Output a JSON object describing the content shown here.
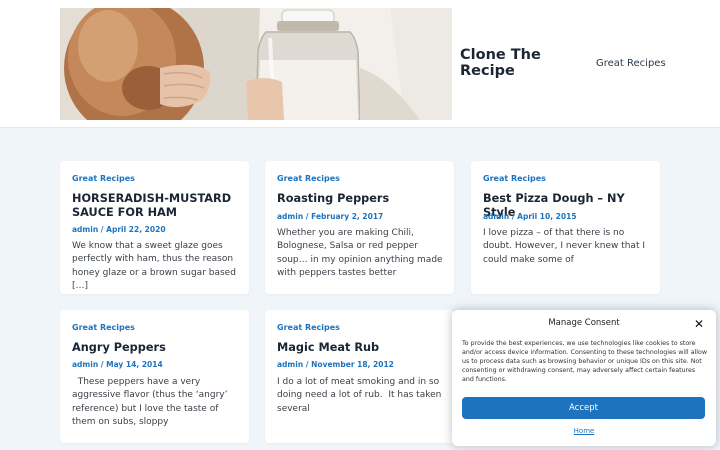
{
  "header": {
    "site_title": "Clone The Recipe",
    "nav": [
      {
        "label": "Great Recipes"
      }
    ]
  },
  "posts": [
    {
      "category": "Great Recipes",
      "title": "HORSERADISH-MUSTARD SAUCE FOR HAM",
      "author": "admin",
      "date": "April 22, 2020",
      "excerpt": "We know that a sweet glaze goes perfectly with ham, thus the reason honey glaze or a brown sugar based […]"
    },
    {
      "category": "Great Recipes",
      "title": "Roasting Peppers",
      "author": "admin",
      "date": "February 2, 2017",
      "excerpt": "Whether you are making Chili, Bolognese, Salsa or red pepper soup… in my opinion anything made with peppers tastes better"
    },
    {
      "category": "Great Recipes",
      "title": "Best Pizza Dough – NY Style",
      "author": "admin",
      "date": "April 10, 2015",
      "excerpt": "I love pizza – of that there is no doubt. However, I never knew that I could make some of"
    },
    {
      "category": "Great Recipes",
      "title": "Angry Peppers",
      "author": "admin",
      "date": "May 14, 2014",
      "excerpt": "  These peppers have a very aggressive flavor (thus the ‘angry’ reference) but I love the taste of them on subs, sloppy"
    },
    {
      "category": "Great Recipes",
      "title": "Magic Meat Rub",
      "author": "admin",
      "date": "November 18, 2012",
      "excerpt": "I do a lot of meat smoking and in so doing need a lot of rub.  It has taken several"
    }
  ],
  "meta_separator": "/",
  "consent": {
    "title": "Manage Consent",
    "text": "To provide the best experiences, we use technologies like cookies to store and/or access device information. Consenting to these technologies will allow us to process data such as browsing behavior or unique IDs on this site. Not consenting or withdrawing consent, may adversely affect certain features and functions.",
    "accept_label": "Accept",
    "link_label": "Home",
    "close_icon": "close-icon"
  },
  "colors": {
    "accent": "#1e73be",
    "background": "#f0f5fa",
    "card": "#ffffff",
    "heading": "#1b2533"
  }
}
